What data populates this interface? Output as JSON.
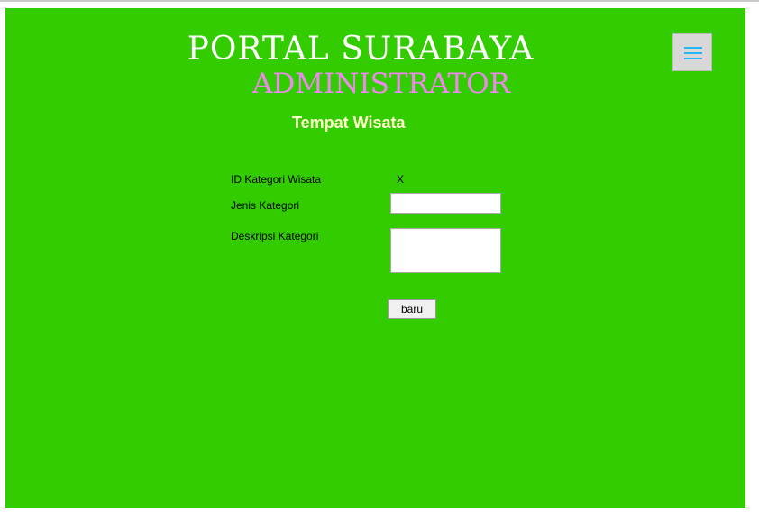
{
  "header": {
    "title": "PORTAL SURABAYA",
    "subtitle": "ADMINISTRATOR",
    "page_heading": "Tempat Wisata"
  },
  "menu": {
    "icon": "hamburger-menu-icon"
  },
  "form": {
    "id_label": "ID Kategori Wisata",
    "id_value": "X",
    "jenis_label": "Jenis Kategori",
    "jenis_value": "",
    "deskripsi_label": "Deskripsi Kategori",
    "deskripsi_value": "",
    "submit_label": "baru"
  },
  "colors": {
    "background": "#33cc00",
    "title": "#ffffff",
    "subtitle": "#ee88ee",
    "heading": "#ffffcc",
    "menu_icon": "#29b6f6"
  }
}
